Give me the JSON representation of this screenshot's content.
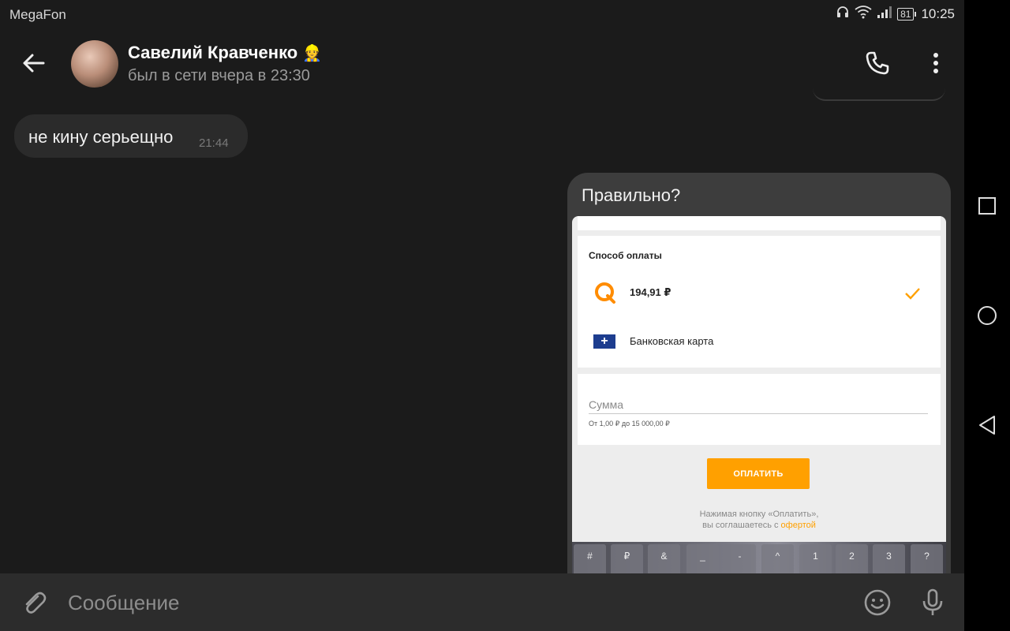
{
  "status_bar": {
    "carrier": "MegaFon",
    "battery": "81",
    "time": "10:25",
    "icons": [
      "headset-icon",
      "wifi-icon",
      "signal-icon",
      "battery-icon"
    ]
  },
  "header": {
    "contact_name": "Савелий Кравченко",
    "name_emoji": "👷",
    "last_seen": "был в сети вчера в 23:30",
    "icons": [
      "back-arrow-icon",
      "phone-icon",
      "more-vertical-icon"
    ]
  },
  "messages": [
    {
      "direction": "incoming",
      "text": "не кину серьещно",
      "time": "21:44"
    },
    {
      "direction": "outgoing",
      "text": "Правильно?",
      "has_image": true
    }
  ],
  "attachment_screenshot": {
    "section_title": "Способ оплаты",
    "options": [
      {
        "icon": "qiwi-icon",
        "label": "194,91 ₽",
        "selected": true
      },
      {
        "icon": "bank-card-icon",
        "label": "Банковская карта",
        "selected": false
      }
    ],
    "amount_placeholder": "Сумма",
    "amount_hint": "От 1,00 ₽ до 15 000,00 ₽",
    "pay_button": "ОПЛАТИТЬ",
    "agreement_text": "Нажимая кнопку «Оплатить»,",
    "agreement_text2": "вы соглашаетесь с",
    "agreement_link": "офертой",
    "keyboard_keys": [
      "#",
      "₽",
      "&",
      "_",
      "-",
      "^",
      "1",
      "2",
      "3",
      "?"
    ],
    "accent_color": "#ffa000"
  },
  "composer": {
    "placeholder": "Сообщение",
    "icons": [
      "paperclip-icon",
      "emoji-icon",
      "microphone-icon"
    ]
  },
  "system_nav": {
    "icons": [
      "recents-square-icon",
      "home-circle-icon",
      "back-triangle-icon"
    ]
  }
}
